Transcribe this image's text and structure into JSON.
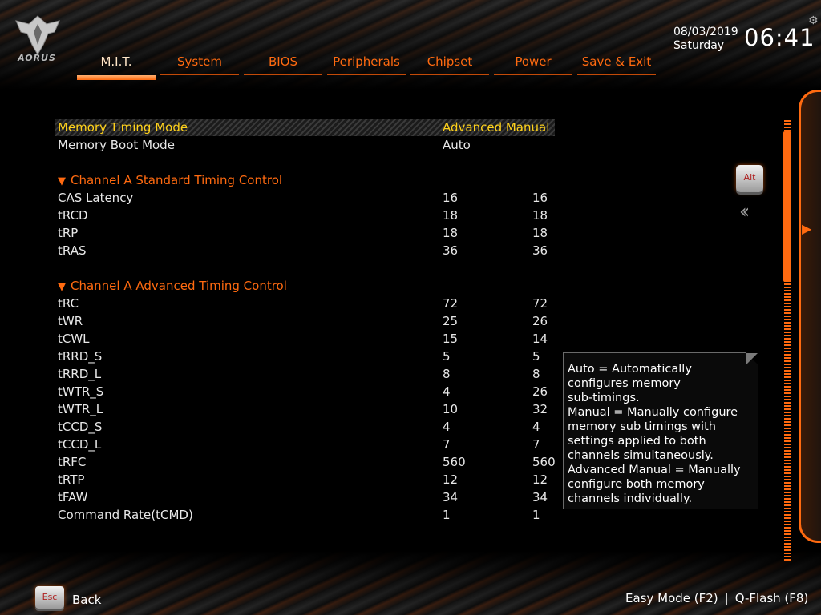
{
  "header": {
    "logo_text": "AORUS",
    "tabs": [
      {
        "label": "M.I.T.",
        "active": true
      },
      {
        "label": "System",
        "active": false
      },
      {
        "label": "BIOS",
        "active": false
      },
      {
        "label": "Peripherals",
        "active": false
      },
      {
        "label": "Chipset",
        "active": false
      },
      {
        "label": "Power",
        "active": false
      },
      {
        "label": "Save & Exit",
        "active": false
      }
    ],
    "date": "08/03/2019",
    "weekday": "Saturday",
    "time": "06:41"
  },
  "settings": {
    "memory_timing_mode": {
      "label": "Memory Timing Mode",
      "value": "Advanced Manual"
    },
    "memory_boot_mode": {
      "label": "Memory Boot Mode",
      "value": "Auto"
    }
  },
  "sections": {
    "standard": {
      "title": "Channel A Standard Timing Control",
      "rows": [
        {
          "label": "CAS Latency",
          "v1": "16",
          "v2": "16"
        },
        {
          "label": "tRCD",
          "v1": "18",
          "v2": "18"
        },
        {
          "label": "tRP",
          "v1": "18",
          "v2": "18"
        },
        {
          "label": "tRAS",
          "v1": "36",
          "v2": "36"
        }
      ]
    },
    "advanced": {
      "title": "Channel A Advanced Timing Control",
      "rows": [
        {
          "label": "tRC",
          "v1": "72",
          "v2": "72"
        },
        {
          "label": "tWR",
          "v1": "25",
          "v2": "26"
        },
        {
          "label": "tCWL",
          "v1": "15",
          "v2": "14"
        },
        {
          "label": "tRRD_S",
          "v1": "5",
          "v2": "5"
        },
        {
          "label": "tRRD_L",
          "v1": "8",
          "v2": "8"
        },
        {
          "label": "tWTR_S",
          "v1": "4",
          "v2": "26"
        },
        {
          "label": "tWTR_L",
          "v1": "10",
          "v2": "32"
        },
        {
          "label": "tCCD_S",
          "v1": "4",
          "v2": "4"
        },
        {
          "label": "tCCD_L",
          "v1": "7",
          "v2": "7"
        },
        {
          "label": "tRFC",
          "v1": "560",
          "v2": "560"
        },
        {
          "label": "tRTP",
          "v1": "12",
          "v2": "12"
        },
        {
          "label": "tFAW",
          "v1": "34",
          "v2": "34"
        },
        {
          "label": "Command Rate(tCMD)",
          "v1": "1",
          "v2": "1"
        }
      ]
    }
  },
  "side": {
    "alt_key": "Alt",
    "scroll_position": 0.04
  },
  "help_text": "Auto = Automatically\nconfigures memory\nsub-timings.\nManual = Manually configure\nmemory sub timings with\nsettings applied to both\nchannels simultaneously.\nAdvanced Manual = Manually\nconfigure both memory\nchannels individually.",
  "footer": {
    "esc_key": "Esc",
    "back_label": "Back",
    "easy_mode": "Easy Mode (F2)",
    "separator": "|",
    "qflash": "Q-Flash (F8)"
  },
  "colors": {
    "accent": "#ff6a10",
    "highlight": "#ffd21a",
    "text": "#ffffff"
  }
}
